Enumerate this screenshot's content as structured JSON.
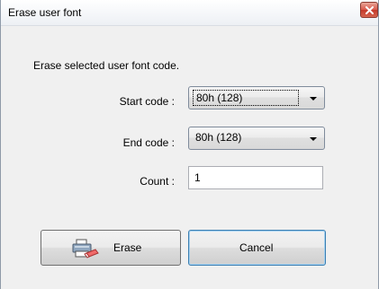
{
  "window": {
    "title": "Erase user font"
  },
  "description": "Erase selected user font code.",
  "fields": {
    "start_code": {
      "label": "Start code :",
      "value": "80h (128)"
    },
    "end_code": {
      "label": "End code :",
      "value": "80h (128)"
    },
    "count": {
      "label": "Count :",
      "value": "1"
    }
  },
  "buttons": {
    "erase": "Erase",
    "cancel": "Cancel"
  },
  "icons": {
    "close": "close-icon",
    "erase": "printer-eraser-icon",
    "dropdown": "chevron-down-icon"
  },
  "colors": {
    "dialog_bg": "#f0f0f0",
    "close_button": "#c4392a",
    "default_button_border": "#3c7fb1"
  }
}
